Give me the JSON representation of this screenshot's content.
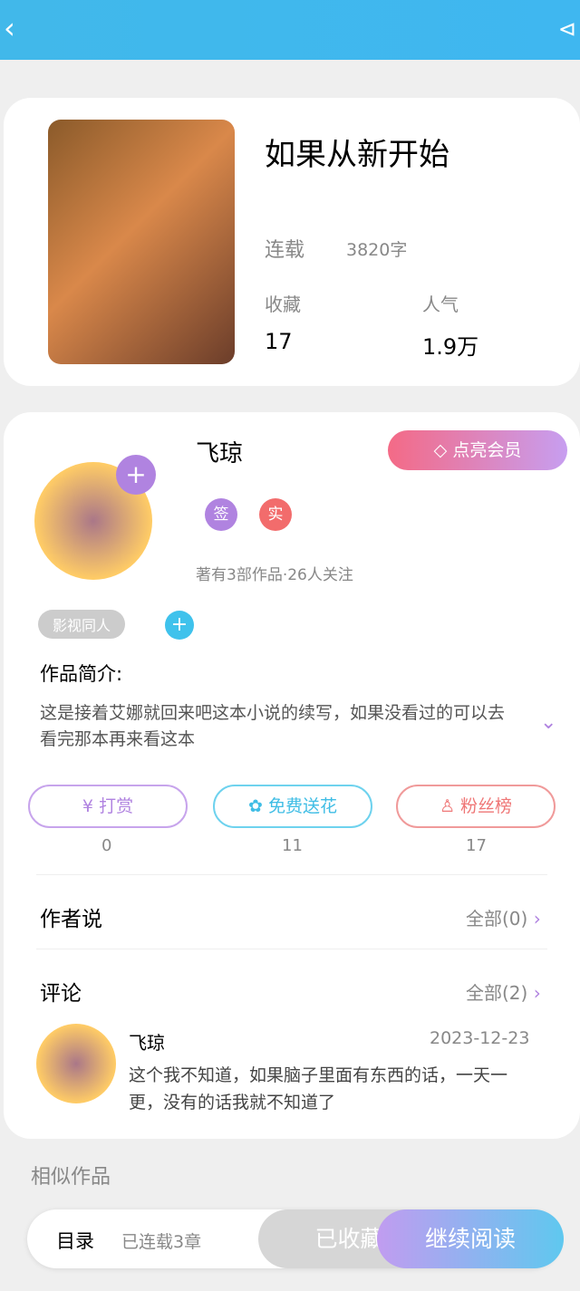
{
  "book": {
    "title": "如果从新开始",
    "status": "连载",
    "words": "3820字",
    "fav_label": "收藏",
    "fav": "17",
    "pop_label": "人气",
    "pop": "1.9万"
  },
  "author": {
    "name": "飞琼",
    "badges": [
      "签",
      "实"
    ],
    "desc": "著有3部作品·26人关注",
    "vip": "点亮会员",
    "tag": "影视同人"
  },
  "intro": {
    "label": "作品简介:",
    "text": "这是接着艾娜就回来吧这本小说的续写，如果没看过的可以去看完那本再来看这本"
  },
  "actions": [
    {
      "label": "打赏",
      "count": "0"
    },
    {
      "label": "免费送花",
      "count": "11"
    },
    {
      "label": "粉丝榜",
      "count": "17"
    }
  ],
  "author_say": {
    "label": "作者说",
    "all": "全部(0)"
  },
  "comments": {
    "label": "评论",
    "all": "全部(2)",
    "name": "飞琼",
    "date": "2023-12-23",
    "text": "这个我不知道，如果脑子里面有东西的话，一天一更，没有的话我就不知道了"
  },
  "similar": "相似作品",
  "bottom": {
    "toc": "目录",
    "chapters": "已连载3章",
    "fav": "已收藏",
    "read": "继续阅读"
  }
}
